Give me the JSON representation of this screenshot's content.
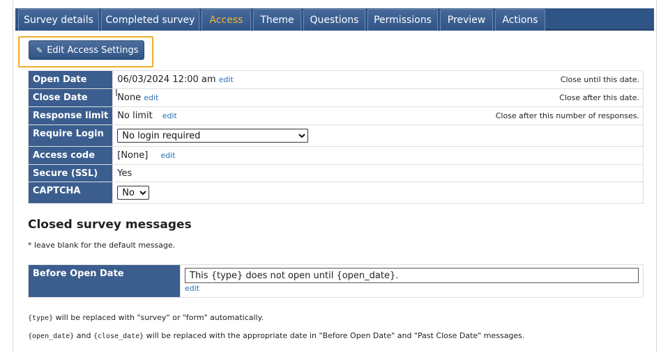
{
  "tabs": [
    {
      "label": "Survey details",
      "active": false
    },
    {
      "label": "Completed survey",
      "active": false
    },
    {
      "label": "Access",
      "active": true
    },
    {
      "label": "Theme",
      "active": false
    },
    {
      "label": "Questions",
      "active": false
    },
    {
      "label": "Permissions",
      "active": false
    },
    {
      "label": "Preview",
      "active": false
    },
    {
      "label": "Actions",
      "active": false
    }
  ],
  "edit_button": {
    "icon": "pencil-icon",
    "label": "Edit Access Settings"
  },
  "access_rows": {
    "open_date": {
      "label": "Open Date",
      "value": "06/03/2024 12:00 am",
      "link": "edit",
      "note": "Close until this date."
    },
    "close_date": {
      "label": "Close Date",
      "value": "None",
      "link": "edit",
      "note": "Close after this date."
    },
    "response_limit": {
      "label": "Response limit",
      "value": "No limit",
      "link": "edit",
      "note": "Close after this number of responses."
    },
    "require_login": {
      "label": "Require Login",
      "selected": "No login required"
    },
    "access_code": {
      "label": "Access code",
      "value": "[None]",
      "link": "edit"
    },
    "secure": {
      "label": "Secure (SSL)",
      "value": "Yes"
    },
    "captcha": {
      "label": "CAPTCHA",
      "selected": "No"
    }
  },
  "closed_messages": {
    "title": "Closed survey messages",
    "hint": "* leave blank for the default message.",
    "before_open": {
      "label": "Before Open Date",
      "value": "This {type} does not open until {open_date}.",
      "link": "edit"
    }
  },
  "footnotes": {
    "line1_code": "{type}",
    "line1_text": " will be replaced with \"survey\" or \"form\" automatically.",
    "line2_code1": "{open_date}",
    "line2_and": " and ",
    "line2_code2": "{close_date}",
    "line2_text": " will be replaced with the appropriate date in \"Before Open Date\" and \"Past Close Date\" messages."
  },
  "colors": {
    "tab_bg": "#2f5586",
    "active_tab_text": "#f4b53a",
    "label_bg": "#3b5e8f",
    "highlight": "#f0ad2e",
    "link": "#2a6fb0"
  }
}
